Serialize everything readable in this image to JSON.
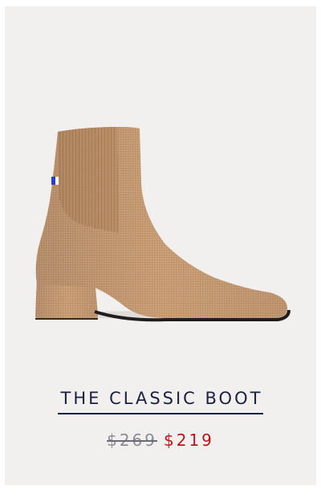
{
  "product": {
    "image_alt": "boot-image",
    "title": "THE CLASSIC BOOT",
    "price_original": "$269",
    "price_sale": "$219"
  },
  "colors": {
    "background": "#f2f0ee",
    "title": "#1b2140",
    "sale_price": "#b8151b",
    "original_price": "#8c8c95",
    "boot": "#c49a72"
  }
}
